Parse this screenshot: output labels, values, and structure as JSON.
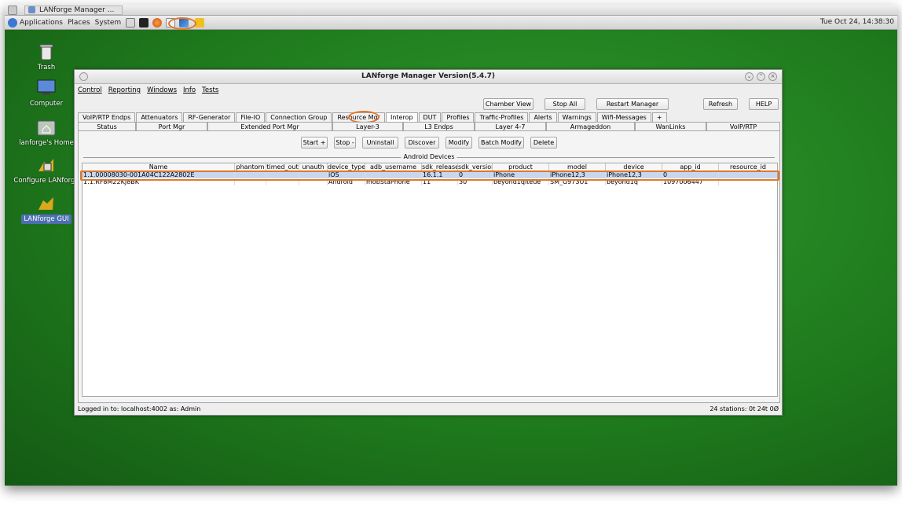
{
  "taskbar": {
    "window_title": "LANforge Manager ..."
  },
  "panel": {
    "menus": [
      "Applications",
      "Places",
      "System"
    ],
    "clock": "Tue Oct 24, 14:38:30"
  },
  "desktop": {
    "icons": [
      {
        "label": "Trash"
      },
      {
        "label": "Computer"
      },
      {
        "label": "lanforge's Home"
      },
      {
        "label": "Configure LANforge"
      },
      {
        "label": "LANforge GUI"
      }
    ]
  },
  "window": {
    "title": "LANforge Manager   Version(5.4.7)",
    "menu": [
      "Control",
      "Reporting",
      "Windows",
      "Info",
      "Tests"
    ],
    "top_buttons": [
      "Chamber View",
      "Stop All",
      "Restart Manager",
      "Refresh",
      "HELP"
    ],
    "tabs_row1": [
      "VoIP/RTP Endps",
      "Attenuators",
      "RF-Generator",
      "File-IO",
      "Connection Group",
      "Resource Mgr",
      "Interop",
      "DUT",
      "Profiles",
      "Traffic-Profiles",
      "Alerts",
      "Warnings",
      "Wifi-Messages",
      "+"
    ],
    "tabs_row1_active": "Interop",
    "tabs_row2": [
      "Status",
      "Port Mgr",
      "Extended Port Mgr",
      "Layer-3",
      "L3 Endps",
      "Layer 4-7",
      "Armageddon",
      "WanLinks",
      "VoIP/RTP"
    ],
    "action_buttons": [
      "Start +",
      "Stop -",
      "Uninstall",
      "Discover",
      "Modify",
      "Batch Modify",
      "Delete"
    ],
    "group_title": "Android Devices",
    "table": {
      "columns": [
        "Name",
        "phantom",
        "timed_out",
        "unauth",
        "device_type",
        "adb_username",
        "sdk_release",
        "sdk_version",
        "product",
        "model",
        "device",
        "app_id",
        "resource_id"
      ],
      "rows": [
        [
          "1.1.00008030-001A04C122A2802E",
          "",
          "",
          "",
          "iOS",
          "",
          "16.1.1",
          "0",
          "iPhone",
          "iPhone12,3",
          "iPhone12,3",
          "0",
          ""
        ],
        [
          "1.1.RF8M22KJ8BK",
          "",
          "",
          "",
          "Android",
          "mobStaPhone",
          "11",
          "30",
          "beyond1qlteue",
          "SM_G973U1",
          "beyond1q",
          "1097006447",
          ""
        ]
      ]
    },
    "status_left": "Logged in to:  localhost:4002  as:  Admin",
    "status_right": "24 stations: 0t 24t 0Ø"
  },
  "colors": {
    "highlight": "#e0772a",
    "desktop": "#1f7a1d",
    "selection": "#c9d7ee"
  }
}
